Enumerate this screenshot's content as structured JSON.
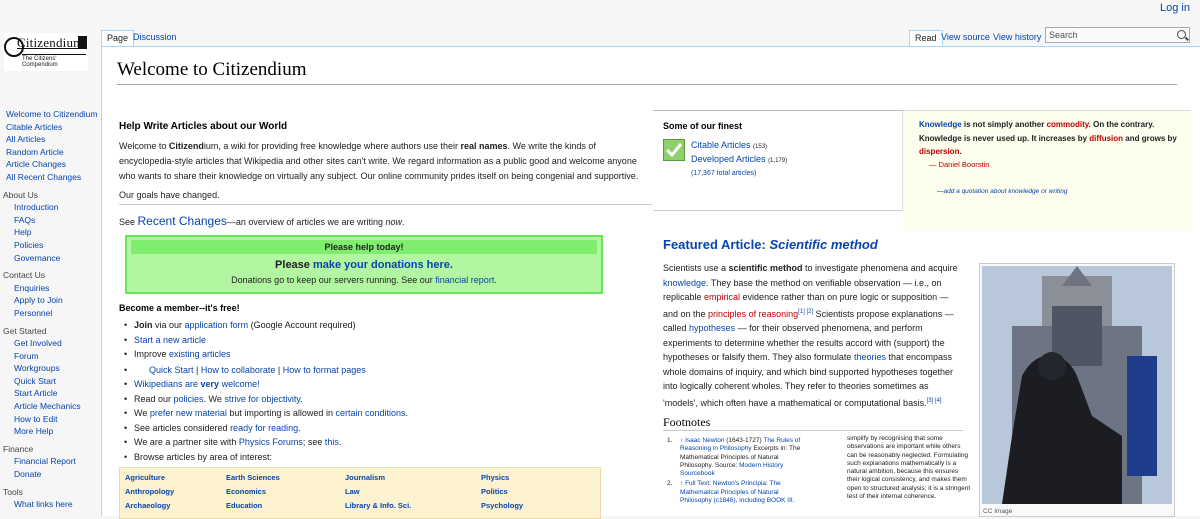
{
  "header": {
    "login": "Log in"
  },
  "logo": {
    "name": "Citizendium",
    "tagline": "The Citizens' Compendium"
  },
  "tabs_left": [
    "Page",
    "Discussion"
  ],
  "tabs_right": [
    "Read",
    "View source",
    "View history"
  ],
  "search": {
    "placeholder": "Search"
  },
  "sidebar": {
    "main": [
      "Welcome to Citizendium",
      "Citable Articles",
      "All Articles",
      "Random Article",
      "Article Changes",
      "All Recent Changes"
    ],
    "about_head": "About Us",
    "about": [
      "Introduction",
      "FAQs",
      "Help",
      "Policies",
      "Governance"
    ],
    "contact_head": "Contact Us",
    "contact": [
      "Enquiries",
      "Apply to Join",
      "Personnel"
    ],
    "start_head": "Get Started",
    "start": [
      "Get Involved",
      "Forum",
      "Workgroups",
      "Quick Start",
      "Start Article",
      "Article Mechanics",
      "How to Edit",
      "More Help"
    ],
    "finance_head": "Finance",
    "finance": [
      "Financial Report",
      "Donate"
    ],
    "tools_head": "Tools",
    "tools": [
      "What links here"
    ]
  },
  "page_title": "Welcome to Citizendium",
  "help": {
    "heading": "Help Write Articles about our World",
    "intro_1": "Welcome to ",
    "intro_bold_1": "Citizend",
    "intro_2": "ium, a wiki for providing free knowledge where authors use their ",
    "intro_bold_2": "real names",
    "intro_3": ". We write the kinds of encyclopedia-style articles that Wikipedia and other sites can't write. We regard information as a public good and welcome anyone who wants to share their knowledge on virtually any subject. Our online community prides itself on being congenial and supportive.",
    "goals": "Our goals have changed.",
    "see": "See ",
    "recent_changes": "Recent Changes",
    "overview": "—an overview of articles we are writing ",
    "now": "now",
    "period": "."
  },
  "donate_box": {
    "title": "Please help today!",
    "please": "Please ",
    "link": "make your donations here.",
    "line_1": "Donations go to keep our servers running. See our ",
    "report": "financial report",
    "end": "."
  },
  "member": {
    "heading": "Become a member--it's free!",
    "join": "Join",
    "via": " via our ",
    "app_form": "application form",
    "google": " (Google Account required)",
    "start_new": "Start a new article",
    "improve": "Improve ",
    "existing": "existing articles",
    "quick_start": "Quick Start",
    "collab": "How to collaborate",
    "format": "How to format pages",
    "sep": " | ",
    "wikipedians": "Wikipedians are ",
    "very": "very",
    "welcome": " welcome!",
    "read_our": "Read our ",
    "policies": "policies",
    "we": ". We ",
    "strive": "strive for objectivity",
    "we2": "We ",
    "prefer": "prefer new material",
    "importing": " but importing is allowed in ",
    "certain": "certain conditions",
    "see_cons": "See articles considered ",
    "ready": "ready for reading",
    "partner": "We are a partner site with ",
    "physics": "Physics Forums",
    "see_this": "; see ",
    "this": "this",
    "browse": "Browse articles by area of interest:"
  },
  "areas": [
    "Agriculture",
    "Earth Sciences",
    "Journalism",
    "Physics",
    "Anthropology",
    "Economics",
    "Law",
    "Politics",
    "Archaeology",
    "Education",
    "Library & Info. Sci.",
    "Psychology"
  ],
  "finest": {
    "heading": "Some of our finest",
    "citable": "Citable Articles",
    "citable_count": "(153)",
    "developed": "Developed Articles",
    "developed_count": "(1,179)",
    "total": "(17,367 total articles)"
  },
  "quote": {
    "knowledge": "Knowledge",
    "t1": " is not simply another ",
    "commodity": "commodity",
    "t2": ". On the contrary. Knowledge is never used up. It increases by ",
    "diffusion": "diffusion",
    "t3": " and grows by ",
    "dispersion": "dispersion",
    "t4": ".",
    "author": "— Daniel Boorstin",
    "add": "—add a quotation about knowledge or writing"
  },
  "featured": {
    "label": "Featured Article: ",
    "article": "Scientific method",
    "s1": "Scientists use a ",
    "s1b": "scientific method",
    "s2": " to investigate phenomena and acquire ",
    "knowledge": "knowledge",
    "s3": ". They base the method on verifiable observation — i.e., on replicable ",
    "empirical": "empirical",
    "s4": " evidence rather than on pure logic or supposition — and on the ",
    "principles": "principles of reasoning",
    "ref12": "[1] [2]",
    "s5": " Scientists propose explanations — called ",
    "hypotheses": "hypotheses",
    "s6": " — for their observed phenomena, and perform experiments to determine whether the results accord with (support) the hypotheses or falsify them. They also formulate ",
    "theories": "theories",
    "s7": " that encompass whole domains of inquiry, and which bind supported hypotheses together into logically coherent wholes. They refer to theories sometimes as 'models', which often have a mathematical or computational basis.",
    "ref34": "[3] [4]",
    "footnotes": "Footnotes",
    "caption": "CC Image"
  },
  "footnotes": {
    "n1_num": "1.",
    "n1_arrow": "↑",
    "n1_author": "Isaac Newton",
    "n1_years": " (1643-1727) ",
    "n1_link": "The Rules of Reasoning in Philosophy",
    "n1_rest": " Excerpts in: The Mathematical Principles of Natural Philosophy. Source: ",
    "n1_src": "Modern History Sourcebook",
    "n2_num": "2.",
    "n2_arrow": "↑",
    "n2_link": "Full Text: Newton's Principia: The Mathematical Principles of Natural Philosophy (c1846), including BOOK III.",
    "right_col": "simplify by recognising that some observations are important while others can be reasonably neglected. Formulating such explanations mathematically is a natural ambition, because this ensures their logical consistency, and makes them open to structured analysis; it is a stringent test of their internal coherence."
  }
}
